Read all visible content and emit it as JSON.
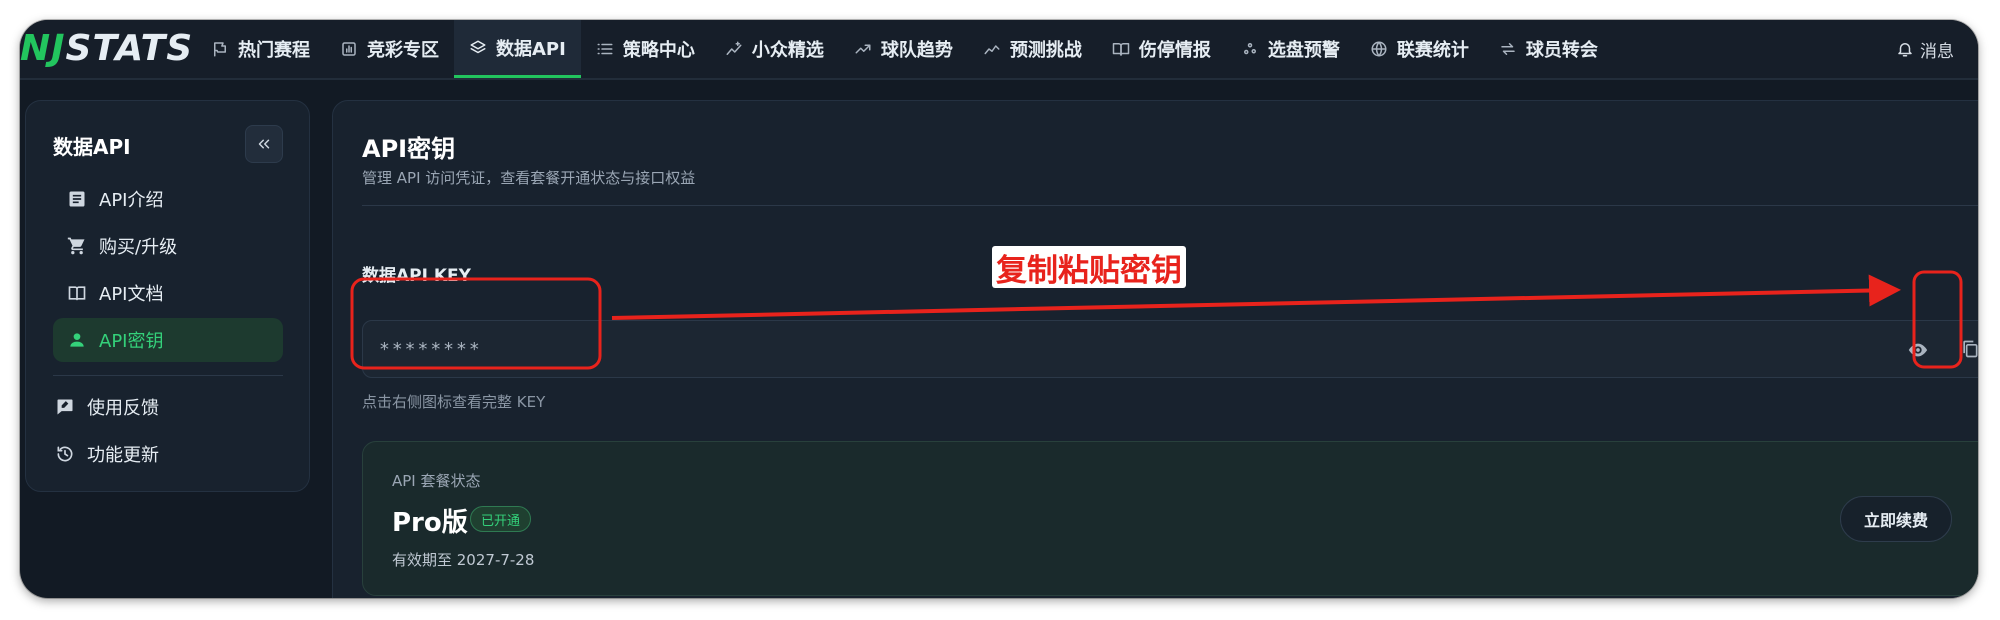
{
  "brand": {
    "logo_part1": "NJ",
    "logo_part2": "STATS"
  },
  "nav": {
    "items": [
      {
        "label": "热门赛程",
        "icon": "flag-icon"
      },
      {
        "label": "竞彩专区",
        "icon": "bar-chart-icon"
      },
      {
        "label": "数据API",
        "icon": "layers-icon",
        "active": true
      },
      {
        "label": "策略中心",
        "icon": "list-icon"
      },
      {
        "label": "小众精选",
        "icon": "trend-sparkle-icon"
      },
      {
        "label": "球队趋势",
        "icon": "trending-up-icon"
      },
      {
        "label": "预测挑战",
        "icon": "chart-line-icon"
      },
      {
        "label": "伤停情报",
        "icon": "book-icon"
      },
      {
        "label": "选盘预警",
        "icon": "scatter-icon"
      },
      {
        "label": "联赛统计",
        "icon": "globe-icon"
      },
      {
        "label": "球员转会",
        "icon": "swap-icon"
      }
    ],
    "messages_label": "消息"
  },
  "sidebar": {
    "title": "数据API",
    "items": [
      {
        "label": "API介绍",
        "icon": "article-icon"
      },
      {
        "label": "购买/升级",
        "icon": "cart-icon"
      },
      {
        "label": "API文档",
        "icon": "book-icon"
      },
      {
        "label": "API密钥",
        "icon": "person-icon",
        "active": true
      }
    ],
    "extra_items": [
      {
        "label": "使用反馈",
        "icon": "feedback-icon"
      },
      {
        "label": "功能更新",
        "icon": "history-icon"
      }
    ]
  },
  "main": {
    "title": "API密钥",
    "subtitle": "管理 API 访问凭证，查看套餐开通状态与接口权益",
    "key_section_label": "数据API KEY",
    "key_value": "********",
    "key_hint": "点击右侧图标查看完整 KEY",
    "plan": {
      "label": "API 套餐状态",
      "name": "Pro版",
      "badge": "已开通",
      "expiry": "有效期至 2027-7-28",
      "renew_label": "立即续费"
    }
  },
  "annotation": {
    "label": "复制粘贴密钥",
    "color": "#e8231c"
  },
  "colors": {
    "accent": "#22c55e",
    "background": "#121a24",
    "panel": "#18222e"
  }
}
